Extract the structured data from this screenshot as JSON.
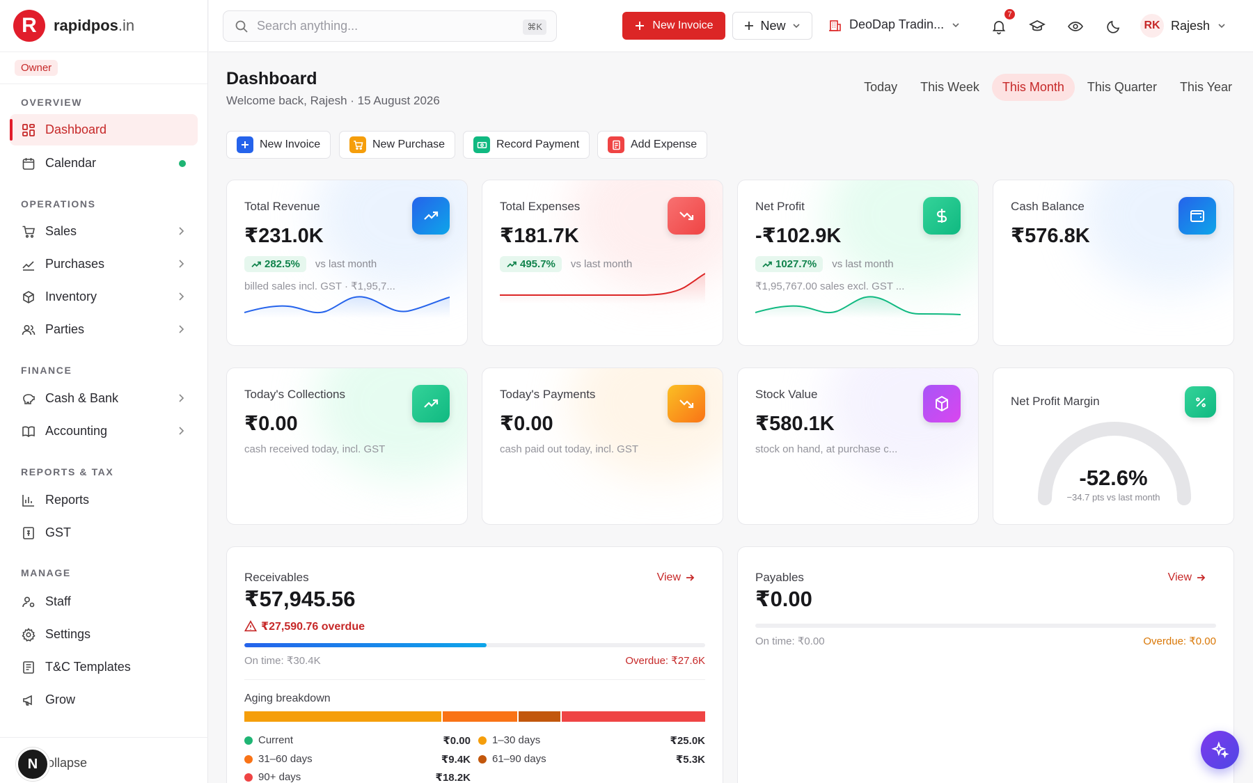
{
  "brand": {
    "name": "rapidpos",
    "tld": ".in",
    "logo_letter": "R"
  },
  "sidebar": {
    "role": "Owner",
    "sections": {
      "overview": "OVERVIEW",
      "operations": "OPERATIONS",
      "finance": "FINANCE",
      "reports": "REPORTS & TAX",
      "manage": "MANAGE"
    },
    "items": {
      "dashboard": "Dashboard",
      "calendar": "Calendar",
      "sales": "Sales",
      "purchases": "Purchases",
      "inventory": "Inventory",
      "parties": "Parties",
      "cash_bank": "Cash & Bank",
      "accounting": "Accounting",
      "reports": "Reports",
      "gst": "GST",
      "staff": "Staff",
      "settings": "Settings",
      "tc_templates": "T&C Templates",
      "grow": "Grow"
    },
    "collapse": "Collapse",
    "dev_badge": "N"
  },
  "topbar": {
    "search_placeholder": "Search anything...",
    "search_shortcut": "⌘K",
    "new_invoice": "New Invoice",
    "new": "New",
    "company": "DeoDap Tradin...",
    "notif_count": "7",
    "user_initials": "RK",
    "user_name": "Rajesh"
  },
  "page": {
    "title": "Dashboard",
    "subtitle": "Welcome back, Rajesh · 15 August 2026",
    "tabs": [
      "Today",
      "This Week",
      "This Month",
      "This Quarter",
      "This Year"
    ],
    "active_tab": "This Month"
  },
  "quick_actions": {
    "new_invoice": "New Invoice",
    "new_purchase": "New Purchase",
    "record_payment": "Record Payment",
    "add_expense": "Add Expense"
  },
  "kpis": {
    "revenue": {
      "label": "Total Revenue",
      "value": "₹231.0K",
      "trend": "282.5%",
      "trend_text": "vs last month",
      "note": "billed sales incl. GST · ₹1,95,7..."
    },
    "expenses": {
      "label": "Total Expenses",
      "value": "₹181.7K",
      "trend": "495.7%",
      "trend_text": "vs last month"
    },
    "profit": {
      "label": "Net Profit",
      "value": "-₹102.9K",
      "trend": "1027.7%",
      "trend_text": "vs last month",
      "note": "₹1,95,767.00 sales excl. GST ..."
    },
    "cash": {
      "label": "Cash Balance",
      "value": "₹576.8K"
    },
    "collections": {
      "label": "Today's Collections",
      "value": "₹0.00",
      "note": "cash received today, incl. GST"
    },
    "payments": {
      "label": "Today's Payments",
      "value": "₹0.00",
      "note": "cash paid out today, incl. GST"
    },
    "stock": {
      "label": "Stock Value",
      "value": "₹580.1K",
      "note": "stock on hand, at purchase c..."
    },
    "margin": {
      "label": "Net Profit Margin",
      "value": "-52.6%",
      "sub": "−34.7 pts vs last month",
      "gauge_fraction": 0.0
    }
  },
  "receivables": {
    "title": "Receivables",
    "view": "View",
    "value": "₹57,945.56",
    "overdue_warn": "₹27,590.76 overdue",
    "on_time": "On time: ₹30.4K",
    "overdue": "Overdue: ₹27.6K",
    "progress_fraction": 0.525,
    "aging_title": "Aging breakdown",
    "aging": [
      {
        "label": "Current",
        "value": "₹0.00",
        "color": "#1fb574",
        "share": 0
      },
      {
        "label": "1–30 days",
        "value": "₹25.0K",
        "color": "#f59e0b",
        "share": 25.0
      },
      {
        "label": "31–60 days",
        "value": "₹9.4K",
        "color": "#f97316",
        "share": 9.4
      },
      {
        "label": "61–90 days",
        "value": "₹5.3K",
        "color": "#c2570c",
        "share": 5.3
      },
      {
        "label": "90+ days",
        "value": "₹18.2K",
        "color": "#ef4444",
        "share": 18.2
      }
    ]
  },
  "payables": {
    "title": "Payables",
    "view": "View",
    "value": "₹0.00",
    "on_time": "On time: ₹0.00",
    "overdue": "Overdue: ₹0.00",
    "progress_fraction": 0
  },
  "colors": {
    "brand": "#dc2626",
    "active_bg": "#fdeeee",
    "positive": "#11834c",
    "overdue": "#c62828",
    "warning": "#d97706"
  }
}
